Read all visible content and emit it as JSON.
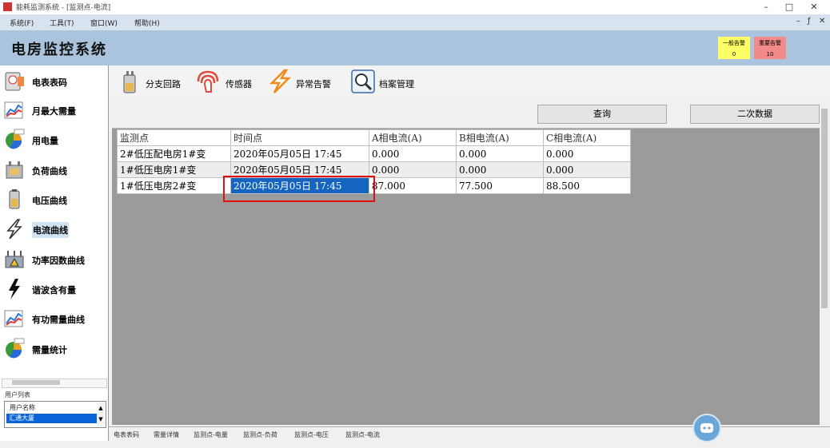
{
  "window": {
    "title": "能耗监测系统 - [监测点-电流]",
    "minimize": "–",
    "maximize": "□",
    "close": "✕"
  },
  "menu": {
    "items": [
      "系统(F)",
      "工具(T)",
      "窗口(W)",
      "帮助(H)"
    ],
    "mdi_controls": [
      "–",
      "ƒ",
      "✕"
    ]
  },
  "header": {
    "app_title": "电房监控系统",
    "alarms": [
      {
        "label": "一般告警",
        "count": "0",
        "color": "#ffff66"
      },
      {
        "label": "重要告警",
        "count": "10",
        "color": "#f28a8a"
      }
    ]
  },
  "sidebar": {
    "items": [
      {
        "label": "电表表码",
        "icon": "meter-icon"
      },
      {
        "label": "月最大需量",
        "icon": "chart-icon"
      },
      {
        "label": "用电量",
        "icon": "pie-icon"
      },
      {
        "label": "负荷曲线",
        "icon": "transformer-icon"
      },
      {
        "label": "电压曲线",
        "icon": "battery-icon"
      },
      {
        "label": "电流曲线",
        "icon": "lightning-icon"
      },
      {
        "label": "功率因数曲线",
        "icon": "substation-icon"
      },
      {
        "label": "谐波含有量",
        "icon": "bolt-icon"
      },
      {
        "label": "有功需量曲线",
        "icon": "chart-icon"
      },
      {
        "label": "需量统计",
        "icon": "pie-icon"
      }
    ],
    "active_label": "电流曲线",
    "user_list_label": "用户列表",
    "user_list_header": "用户名称",
    "user_list_selected": "汇通大厦"
  },
  "toolbar": {
    "items": [
      {
        "label": "分支回路",
        "icon": "branch-icon"
      },
      {
        "label": "传感器",
        "icon": "sensor-icon"
      },
      {
        "label": "异常告警",
        "icon": "alarm-bolt-icon"
      },
      {
        "label": "档案管理",
        "icon": "search-file-icon"
      }
    ]
  },
  "actions": {
    "query": "查询",
    "secondary": "二次数据"
  },
  "table": {
    "columns": [
      "监测点",
      "时间点",
      "A相电流(A)",
      "B相电流(A)",
      "C相电流(A)"
    ],
    "rows": [
      [
        "2#低压配电房1#变",
        "2020年05月05日  17:45",
        "0.000",
        "0.000",
        "0.000"
      ],
      [
        "1#低压电房1#变",
        "2020年05月05日  17:45",
        "0.000",
        "0.000",
        "0.000"
      ],
      [
        "1#低压电房2#变",
        "2020年05月05日  17:45",
        "87.000",
        "77.500",
        "88.500"
      ]
    ]
  },
  "bottom_tabs": [
    "电表表码",
    "需量详情",
    "监测点-电量",
    "监测点-负荷",
    "监测点-电压",
    "监测点-电流"
  ]
}
